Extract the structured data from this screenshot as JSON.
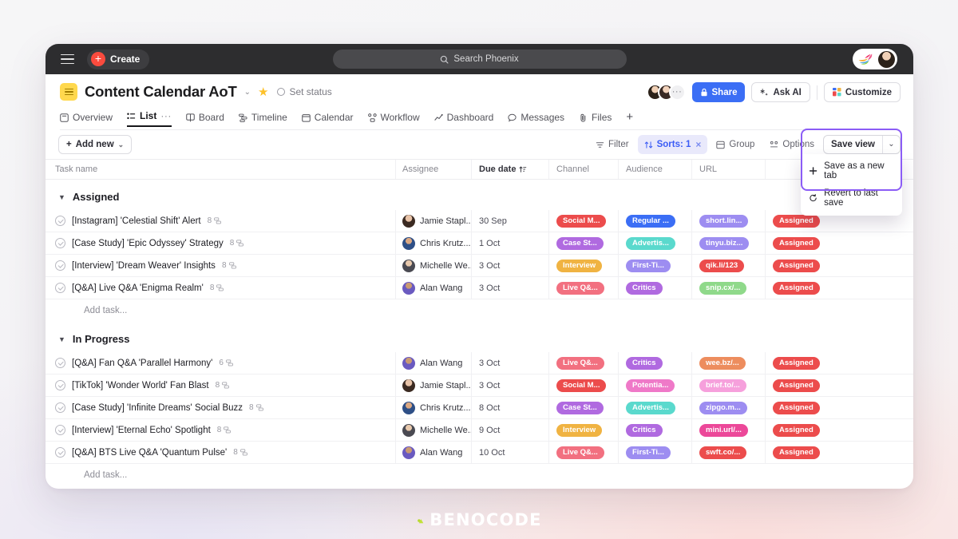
{
  "topbar": {
    "menu_icon": "hamburger-icon",
    "create_label": "Create",
    "search_placeholder": "Search Phoenix",
    "search_icon": "search-icon"
  },
  "header": {
    "title": "Content Calendar AoT",
    "doc_icon": "list-doc-icon",
    "chevron": "⌄",
    "star_icon": "star-icon",
    "set_status": "Set status",
    "share_label": "Share",
    "ask_ai_label": "Ask AI",
    "customize_label": "Customize",
    "avatar_more": "···",
    "tabs": [
      {
        "label": "Overview",
        "icon": "overview-icon",
        "active": false
      },
      {
        "label": "List",
        "icon": "list-icon",
        "active": true,
        "dots": "···"
      },
      {
        "label": "Board",
        "icon": "board-icon",
        "active": false
      },
      {
        "label": "Timeline",
        "icon": "timeline-icon",
        "active": false
      },
      {
        "label": "Calendar",
        "icon": "calendar-icon",
        "active": false
      },
      {
        "label": "Workflow",
        "icon": "workflow-icon",
        "active": false
      },
      {
        "label": "Dashboard",
        "icon": "dashboard-icon",
        "active": false
      },
      {
        "label": "Messages",
        "icon": "messages-icon",
        "active": false
      },
      {
        "label": "Files",
        "icon": "files-icon",
        "active": false
      }
    ],
    "add_tab": "+"
  },
  "toolbar": {
    "add_new": "Add new",
    "filter": "Filter",
    "sorts": "Sorts: 1",
    "sorts_clear": "×",
    "group": "Group",
    "options": "Options",
    "save_view": "Save view",
    "save_view_caret": "⌄"
  },
  "dropdown": {
    "items": [
      {
        "label": "Save as a new tab",
        "icon": "plus-icon"
      },
      {
        "label": "Revert to last save",
        "icon": "revert-icon"
      }
    ],
    "border_color": "#8b5cf6"
  },
  "table": {
    "columns": [
      "Task name",
      "Assignee",
      "Due date",
      "Channel",
      "Audience",
      "URL",
      ""
    ],
    "sort_icon": "sort-ascending-icon",
    "add_task_label": "Add task...",
    "groups": [
      {
        "name": "Assigned",
        "rows": [
          {
            "task": "[Instagram] 'Celestial Shift' Alert",
            "subtasks": "8",
            "assignee": "Jamie Stapl...",
            "avatar": "ava-f1",
            "due": "30 Sep",
            "channel": {
              "label": "Social M...",
              "color": "#ec4c4c"
            },
            "audience": {
              "label": "Regular ...",
              "color": "#3b6ef5"
            },
            "url": {
              "label": "short.lin...",
              "color": "#9d8df1"
            },
            "status": {
              "label": "Assigned",
              "color": "#ec4c4c"
            }
          },
          {
            "task": "[Case Study] 'Epic Odyssey' Strategy",
            "subtasks": "8",
            "assignee": "Chris Krutz...",
            "avatar": "ava-m1",
            "due": "1 Oct",
            "channel": {
              "label": "Case St...",
              "color": "#b06ae0"
            },
            "audience": {
              "label": "Advertis...",
              "color": "#5ad9cd"
            },
            "url": {
              "label": "tinyu.biz...",
              "color": "#9d8df1"
            },
            "status": {
              "label": "Assigned",
              "color": "#ec4c4c"
            }
          },
          {
            "task": "[Interview] 'Dream Weaver' Insights",
            "subtasks": "8",
            "assignee": "Michelle We...",
            "avatar": "ava-m3",
            "due": "3 Oct",
            "channel": {
              "label": "Interview",
              "color": "#f0b342"
            },
            "audience": {
              "label": "First-Ti...",
              "color": "#9d8df1"
            },
            "url": {
              "label": "qik.li/123",
              "color": "#ec4c4c"
            },
            "status": {
              "label": "Assigned",
              "color": "#ec4c4c"
            }
          },
          {
            "task": "[Q&A] Live Q&A 'Enigma Realm'",
            "subtasks": "8",
            "assignee": "Alan Wang",
            "avatar": "ava-m2",
            "due": "3 Oct",
            "channel": {
              "label": "Live Q&...",
              "color": "#f27080"
            },
            "audience": {
              "label": "Critics",
              "color": "#b06ae0"
            },
            "url": {
              "label": "snip.cx/...",
              "color": "#8fd98a"
            },
            "status": {
              "label": "Assigned",
              "color": "#ec4c4c"
            }
          }
        ]
      },
      {
        "name": "In Progress",
        "rows": [
          {
            "task": "[Q&A] Fan Q&A 'Parallel Harmony'",
            "subtasks": "6",
            "assignee": "Alan Wang",
            "avatar": "ava-m2",
            "due": "3 Oct",
            "channel": {
              "label": "Live Q&...",
              "color": "#f27080"
            },
            "audience": {
              "label": "Critics",
              "color": "#b06ae0"
            },
            "url": {
              "label": "wee.bz/...",
              "color": "#ed8d5e"
            },
            "status": {
              "label": "Assigned",
              "color": "#ec4c4c"
            }
          },
          {
            "task": "[TikTok] 'Wonder World' Fan Blast",
            "subtasks": "8",
            "assignee": "Jamie Stapl...",
            "avatar": "ava-f1",
            "due": "3 Oct",
            "channel": {
              "label": "Social M...",
              "color": "#ec4c4c"
            },
            "audience": {
              "label": "Potentia...",
              "color": "#ef79c8"
            },
            "url": {
              "label": "brief.to/...",
              "color": "#f6a0dc"
            },
            "status": {
              "label": "Assigned",
              "color": "#ec4c4c"
            }
          },
          {
            "task": "[Case Study] 'Infinite Dreams' Social Buzz",
            "subtasks": "8",
            "assignee": "Chris Krutz...",
            "avatar": "ava-m1",
            "due": "8 Oct",
            "channel": {
              "label": "Case St...",
              "color": "#b06ae0"
            },
            "audience": {
              "label": "Advertis...",
              "color": "#5ad9cd"
            },
            "url": {
              "label": "zipgo.m...",
              "color": "#9d8df1"
            },
            "status": {
              "label": "Assigned",
              "color": "#ec4c4c"
            }
          },
          {
            "task": "[Interview] 'Eternal Echo' Spotlight",
            "subtasks": "8",
            "assignee": "Michelle We...",
            "avatar": "ava-m3",
            "due": "9 Oct",
            "channel": {
              "label": "Interview",
              "color": "#f0b342"
            },
            "audience": {
              "label": "Critics",
              "color": "#b06ae0"
            },
            "url": {
              "label": "mini.url/...",
              "color": "#ec4899"
            },
            "status": {
              "label": "Assigned",
              "color": "#ec4c4c"
            }
          },
          {
            "task": "[Q&A] BTS Live Q&A 'Quantum Pulse'",
            "subtasks": "8",
            "assignee": "Alan Wang",
            "avatar": "ava-m2",
            "due": "10 Oct",
            "channel": {
              "label": "Live Q&...",
              "color": "#f27080"
            },
            "audience": {
              "label": "First-Ti...",
              "color": "#9d8df1"
            },
            "url": {
              "label": "swft.co/...",
              "color": "#ec4c4c"
            },
            "status": {
              "label": "Assigned",
              "color": "#ec4c4c"
            }
          }
        ]
      }
    ]
  },
  "brand": {
    "text": "BENOCODE",
    "mark_color": "#c3e23a"
  }
}
